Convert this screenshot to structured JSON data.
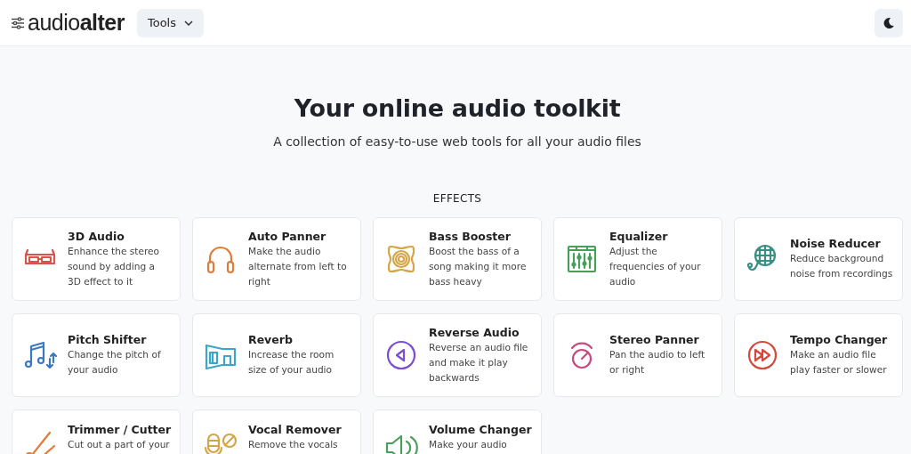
{
  "header": {
    "logo": "audio**alter**",
    "menu_button": "Tools"
  },
  "hero": {
    "title": "Your online audio toolkit",
    "subtitle": "A collection of easy-to-use web tools for all your audio files"
  },
  "section": {
    "title": "EFFECTS",
    "tools": [
      {
        "kind": "glasses",
        "color": "#d9534f",
        "title": "3D Audio",
        "description": "Enhance the stereo sound by adding a 3D effect to it"
      },
      {
        "kind": "headphones",
        "color": "#e07b39",
        "title": "Auto Panner",
        "description": "Make the audio alternate from left to right"
      },
      {
        "kind": "speaker",
        "color": "#d4a647",
        "title": "Bass Booster",
        "description": "Boost the bass of a song making it more bass heavy"
      },
      {
        "kind": "equalizer",
        "color": "#4a9e5c",
        "title": "Equalizer",
        "description": "Adjust the frequencies of your audio"
      },
      {
        "kind": "mic-grille",
        "color": "#3a8f85",
        "title": "Noise Reducer",
        "description": "Reduce background noise from recordings"
      },
      {
        "kind": "note",
        "color": "#3b78c4",
        "title": "Pitch Shifter",
        "description": "Change the pitch of your audio"
      },
      {
        "kind": "room",
        "color": "#3aa6c9",
        "title": "Reverb",
        "description": "Increase the room size of your audio"
      },
      {
        "kind": "reverse",
        "color": "#7b4fd0",
        "title": "Reverse Audio",
        "description": "Reverse an audio file and make it play backwards"
      },
      {
        "kind": "knob",
        "color": "#c94a7d",
        "title": "Stereo Panner",
        "description": "Pan the audio to left or right"
      },
      {
        "kind": "forward",
        "color": "#d24b3e",
        "title": "Tempo Changer",
        "description": "Make an audio file play faster or slower"
      },
      {
        "kind": "scissors",
        "color": "#e07b39",
        "title": "Trimmer / Cutter",
        "description": "Cut out a part of your"
      },
      {
        "kind": "mic-off",
        "color": "#d4a647",
        "title": "Vocal Remover",
        "description": "Remove the vocals"
      },
      {
        "kind": "volume",
        "color": "#4a9e5c",
        "title": "Volume Changer",
        "description": "Make your audio"
      }
    ]
  }
}
